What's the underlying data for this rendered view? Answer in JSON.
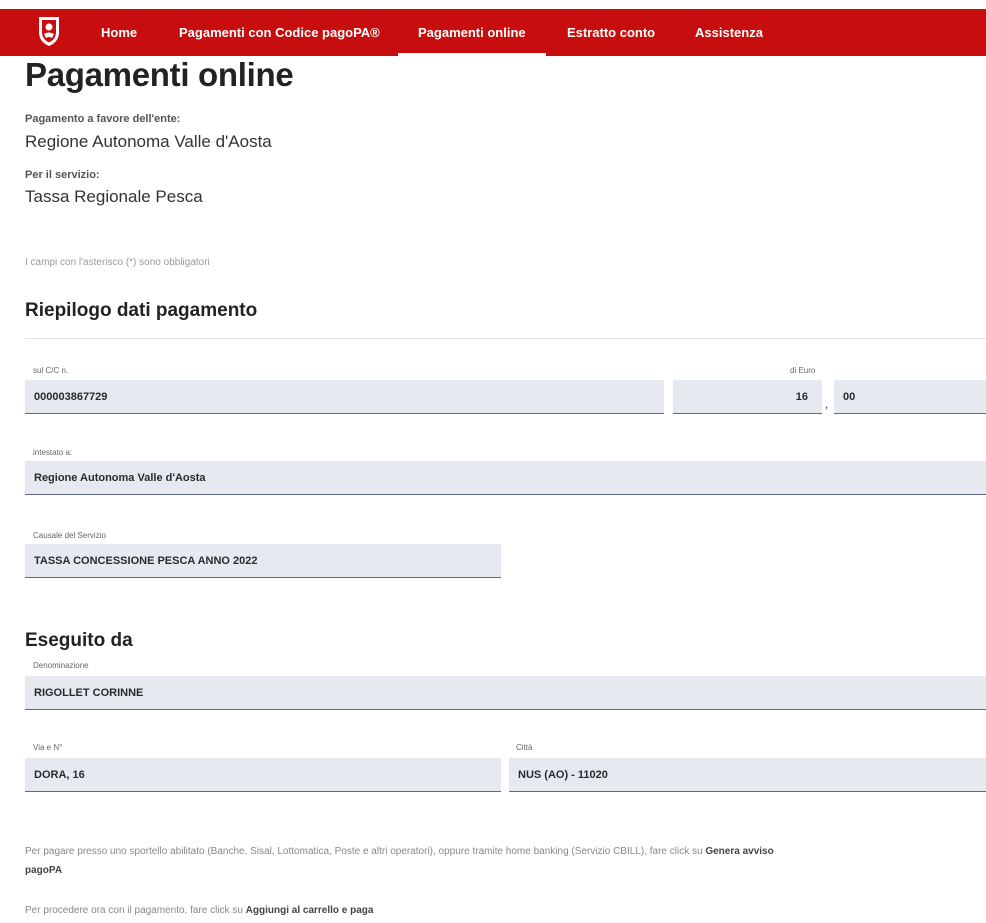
{
  "nav": {
    "items": [
      {
        "label": "Home"
      },
      {
        "label": "Pagamenti con Codice pagoPA®"
      },
      {
        "label": "Pagamenti online"
      },
      {
        "label": "Estratto conto"
      },
      {
        "label": "Assistenza"
      }
    ],
    "active_index": 2
  },
  "page": {
    "title": "Pagamenti online",
    "ente_label": "Pagamento a favore dell'ente:",
    "ente_value": "Regione Autonoma Valle d'Aosta",
    "servizio_label": "Per il servizio:",
    "servizio_value": "Tassa Regionale Pesca",
    "mandatory_note": "I campi con l'asterisco (*) sono obbligatori"
  },
  "riepilogo": {
    "title": "Riepilogo dati pagamento",
    "cc_label": "sul C/C n.",
    "cc_value": "000003867729",
    "euro_label": "di Euro",
    "euro_int": "16",
    "euro_sep": ",",
    "euro_dec": "00",
    "intestato_label": "intestato a:",
    "intestato_value": "Regione Autonoma Valle d'Aosta",
    "causale_label": "Causale del Servizio",
    "causale_value": "TASSA CONCESSIONE PESCA ANNO 2022"
  },
  "eseguito": {
    "title": "Eseguito da",
    "denominazione_label": "Denominazione",
    "denominazione_value": "RIGOLLET CORINNE",
    "via_label": "Via e N°",
    "via_value": "DORA, 16",
    "citta_label": "Città",
    "citta_value": "NUS (AO) - 11020"
  },
  "footer": {
    "p1_text": "Per pagare presso uno sportello abilitato (Banche, Sisal, Lottomatica, Poste e altri operatori), oppure tramite home banking (Servizio CBILL), fare click su ",
    "p1_bold": "Genera avviso pagoPA",
    "p2_text": "Per procedere ora con il pagamento, fare click su ",
    "p2_bold": "Aggiungi al carrello e paga"
  },
  "colors": {
    "navbar": "#c70d0d",
    "field_bg": "#e6e9f0",
    "field_border": "#5f6980"
  },
  "icons": {
    "logo": "regione-vda-coat-of-arms"
  }
}
